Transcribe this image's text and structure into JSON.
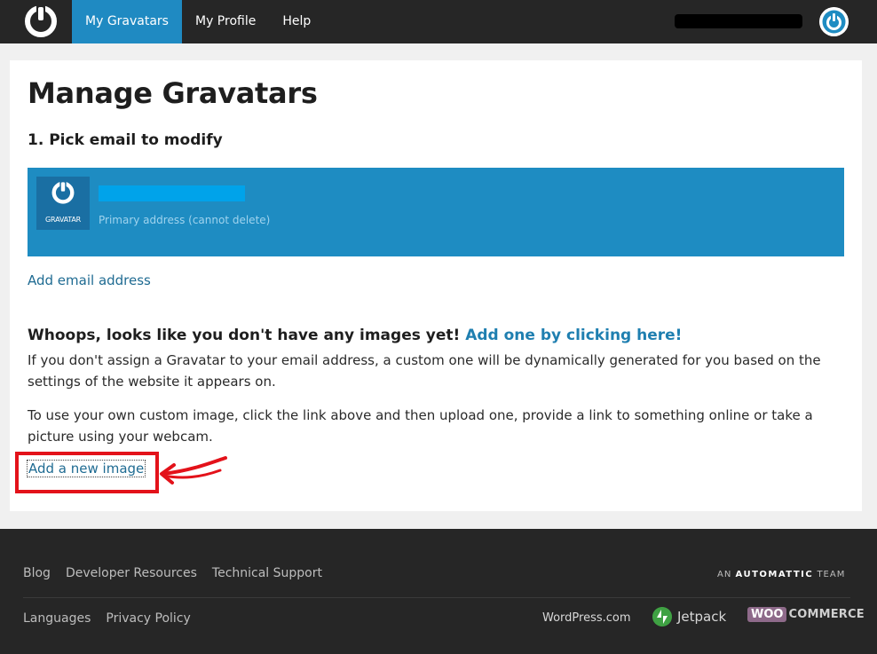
{
  "topbar": {
    "logo_icon": "gravatar-logo-icon",
    "nav": [
      {
        "label": "My Gravatars",
        "active": true
      },
      {
        "label": "My Profile",
        "active": false
      },
      {
        "label": "Help",
        "active": false
      }
    ],
    "avatar_icon": "gravatar-avatar-icon"
  },
  "main": {
    "title": "Manage Gravatars",
    "step_title": "1. Pick email to modify",
    "email": {
      "avatar_label": "GRAVATAR",
      "primary_label": "Primary address (cannot delete)"
    },
    "add_email": "Add email address",
    "whoops_text": "Whoops, looks like you don't have any images yet!",
    "whoops_link": "Add one by clicking here!",
    "para1": "If you don't assign a Gravatar to your email address, a custom one will be dynamically generated for you based on the settings of the website it appears on.",
    "para2": "To use your own custom image, click the link above and then upload one, provide a link to something online or take a picture using your webcam.",
    "add_image": "Add a new image"
  },
  "footer": {
    "links_row1": [
      "Blog",
      "Developer Resources",
      "Technical Support"
    ],
    "links_row2": [
      "Languages",
      "Privacy Policy"
    ],
    "automattic_prefix": "AN",
    "automattic_name": "AUTOMATTIC",
    "automattic_suffix": "TEAM",
    "wordpress": "WordPress.com",
    "jetpack": "Jetpack",
    "woo_badge": "WOO",
    "woo_text": "COMMERCE"
  },
  "colors": {
    "topbar_bg": "#262626",
    "nav_active": "#1f8ac2",
    "email_panel": "#1e8cc2",
    "link": "#1f6b92",
    "annotation": "#e3121a"
  }
}
